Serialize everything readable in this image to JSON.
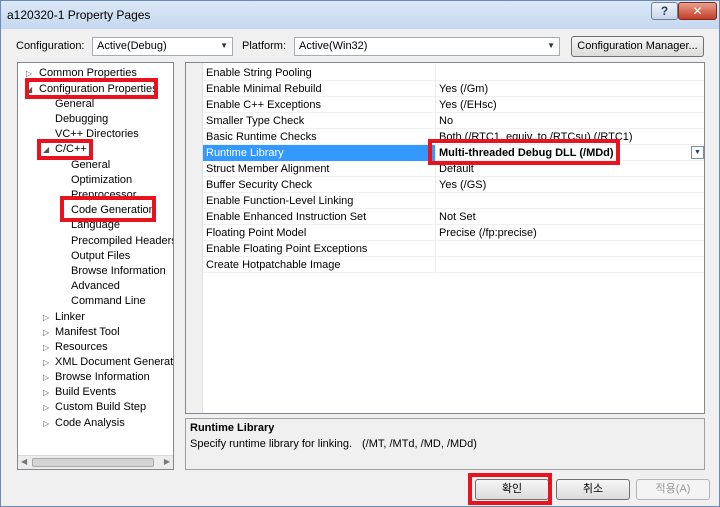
{
  "window": {
    "title": "a120320-1 Property Pages",
    "help": "?",
    "close": "✕"
  },
  "toolbar": {
    "configuration_label": "Configuration:",
    "configuration_value": "Active(Debug)",
    "platform_label": "Platform:",
    "platform_value": "Active(Win32)",
    "config_manager": "Configuration Manager..."
  },
  "tree": {
    "common": "Common Properties",
    "config_props": "Configuration Properties",
    "general": "General",
    "debugging": "Debugging",
    "vcpp_dirs": "VC++ Directories",
    "cpp": "C/C++",
    "cpp_general": "General",
    "optimization": "Optimization",
    "preprocessor": "Preprocessor",
    "code_generation": "Code Generation",
    "language": "Language",
    "precompiled_headers": "Precompiled Headers",
    "output_files": "Output Files",
    "browse_info": "Browse Information",
    "advanced": "Advanced",
    "command_line": "Command Line",
    "linker": "Linker",
    "manifest_tool": "Manifest Tool",
    "resources": "Resources",
    "xml_doc_gen": "XML Document Generator",
    "browse_info2": "Browse Information",
    "build_events": "Build Events",
    "custom_build_step": "Custom Build Step",
    "code_analysis": "Code Analysis"
  },
  "properties": [
    {
      "name": "Enable String Pooling",
      "value": ""
    },
    {
      "name": "Enable Minimal Rebuild",
      "value": "Yes (/Gm)"
    },
    {
      "name": "Enable C++ Exceptions",
      "value": "Yes (/EHsc)"
    },
    {
      "name": "Smaller Type Check",
      "value": "No"
    },
    {
      "name": "Basic Runtime Checks",
      "value": "Both (/RTC1, equiv. to /RTCsu) (/RTC1)"
    },
    {
      "name": "Runtime Library",
      "value": "Multi-threaded Debug DLL (/MDd)"
    },
    {
      "name": "Struct Member Alignment",
      "value": "Default"
    },
    {
      "name": "Buffer Security Check",
      "value": "Yes (/GS)"
    },
    {
      "name": "Enable Function-Level Linking",
      "value": ""
    },
    {
      "name": "Enable Enhanced Instruction Set",
      "value": "Not Set"
    },
    {
      "name": "Floating Point Model",
      "value": "Precise (/fp:precise)"
    },
    {
      "name": "Enable Floating Point Exceptions",
      "value": ""
    },
    {
      "name": "Create Hotpatchable Image",
      "value": ""
    }
  ],
  "description": {
    "title": "Runtime Library",
    "text": "Specify runtime library for linking.",
    "hint": "(/MT, /MTd, /MD, /MDd)"
  },
  "buttons": {
    "ok": "확인",
    "cancel": "취소",
    "apply": "적용(A)"
  },
  "colors": {
    "highlight": "#e8131f",
    "selection": "#3399ff"
  }
}
